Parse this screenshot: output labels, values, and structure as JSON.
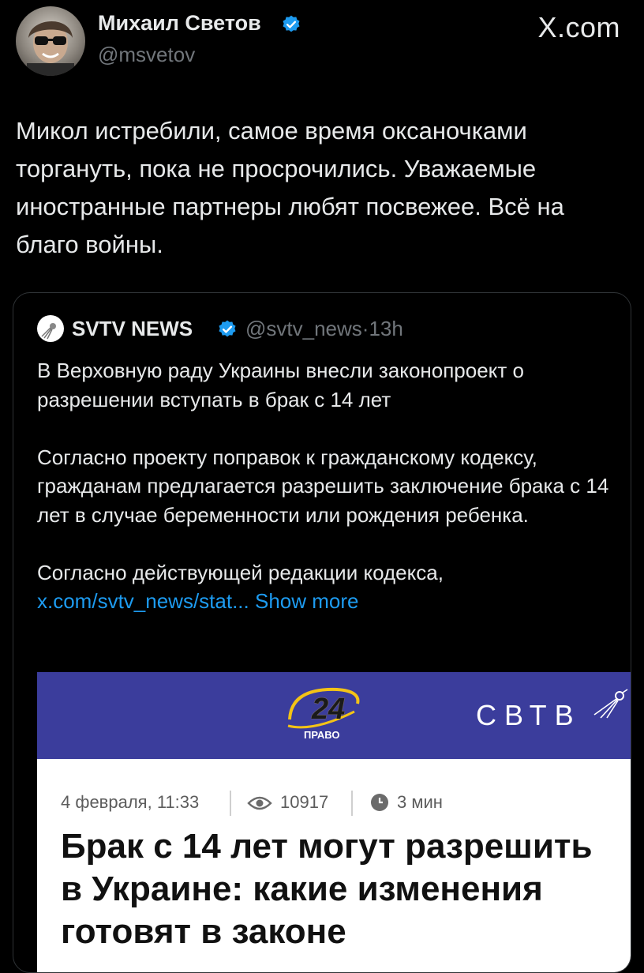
{
  "author": {
    "name": "Михаил Светов",
    "handle": "@msvetov",
    "verified": true
  },
  "watermark": "X.com",
  "tweet": {
    "text": "Микол истребили, самое время оксаночками торгануть, пока не просрочились. Уважаемые иностранные партнеры любят посвежее. Всё на благо войны."
  },
  "quote": {
    "name": "SVTV NEWS",
    "handle": "@svtv_news",
    "separator": "·",
    "time": "13h",
    "paragraph1": "В Верховную раду Украины внесли законопроект о разрешении вступать в брак с 14 лет",
    "paragraph2": "Согласно проекту поправок к гражданскому кодексу, гражданам предлагается разрешить заключение брака с 14 лет в случае беременности или рождения ребенка.",
    "paragraph3": "Согласно действующей редакции кодекса,",
    "link_text": "x.com/svtv_news/stat...",
    "show_more": "Show more"
  },
  "media": {
    "logo_number": "24",
    "logo_sub": "ПРАВО",
    "brand": "СВТВ",
    "date": "4 февраля, 11:33",
    "views": "10917",
    "read_time": "3 мин",
    "headline": "Брак с 14 лет могут разрешить в Украине: какие изменения готовят в законе"
  },
  "colors": {
    "background": "#000000",
    "text": "#e7e9ea",
    "secondary": "#71767b",
    "link": "#1d9bf0",
    "verified": "#1d9bf0",
    "banner": "#3b3d9c",
    "logo_yellow": "#f3c316"
  }
}
